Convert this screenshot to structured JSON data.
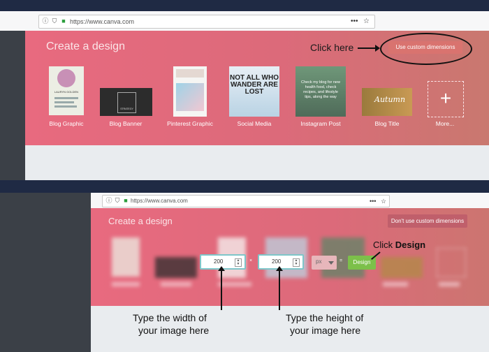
{
  "panel1": {
    "url": "https://www.canva.com",
    "title": "Create a design",
    "annotation": "Click here",
    "custom_button": "Use custom dimensions",
    "templates": [
      {
        "label": "Blog Graphic"
      },
      {
        "label": "Blog Banner"
      },
      {
        "label": "Pinterest Graphic"
      },
      {
        "label": "Social Media",
        "thumb_text": "NOT ALL WHO WANDER ARE LOST"
      },
      {
        "label": "Instagram Post",
        "thumb_text": "Check my blog for new health food, check recipes, and lifestyle tips, along the way"
      },
      {
        "label": "Blog Title",
        "thumb_text": "Autumn"
      },
      {
        "label": "More..."
      }
    ],
    "thumb_blog_graphic_name": "LAURYN GOLDEN",
    "thumb_blog_banner_text": "STRATEGY"
  },
  "panel2": {
    "url": "https://www.canva.com",
    "title": "Create a design",
    "dont_button": "Don't use custom dimensions",
    "width_value": "200",
    "height_value": "200",
    "unit": "px",
    "design_button": "Design",
    "click_design_prefix": "Click ",
    "click_design_bold": "Design",
    "width_hint_line1": "Type the width of",
    "width_hint_line2": "your image here",
    "height_hint_line1": "Type the height of",
    "height_hint_line2": "your image here"
  },
  "icons": [
    "info-icon",
    "shield-icon",
    "lock-icon",
    "more-icon",
    "star-icon",
    "plus-icon"
  ],
  "colors": {
    "hero": "#e86a7f",
    "sidebar": "#3b4047",
    "design_button": "#7cc04a",
    "input_focus": "#7ec6c9"
  }
}
